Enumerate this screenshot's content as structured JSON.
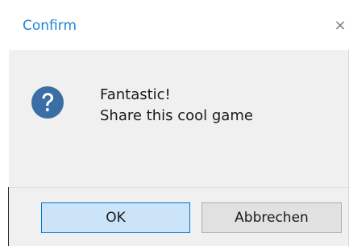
{
  "window": {
    "title": "Confirm",
    "close_glyph": "×"
  },
  "message": {
    "icon": "question-icon",
    "line1": "Fantastic!",
    "line2": "Share this cool game"
  },
  "buttons": {
    "ok_label": "OK",
    "cancel_label": "Abbrechen"
  },
  "colors": {
    "title": "#1e86d8",
    "icon_fill": "#3a6ea5",
    "ok_button_bg": "#cce4f7",
    "ok_button_border": "#0078d7",
    "cancel_button_bg": "#e1e1e1",
    "content_bg": "#f0f0f0"
  }
}
